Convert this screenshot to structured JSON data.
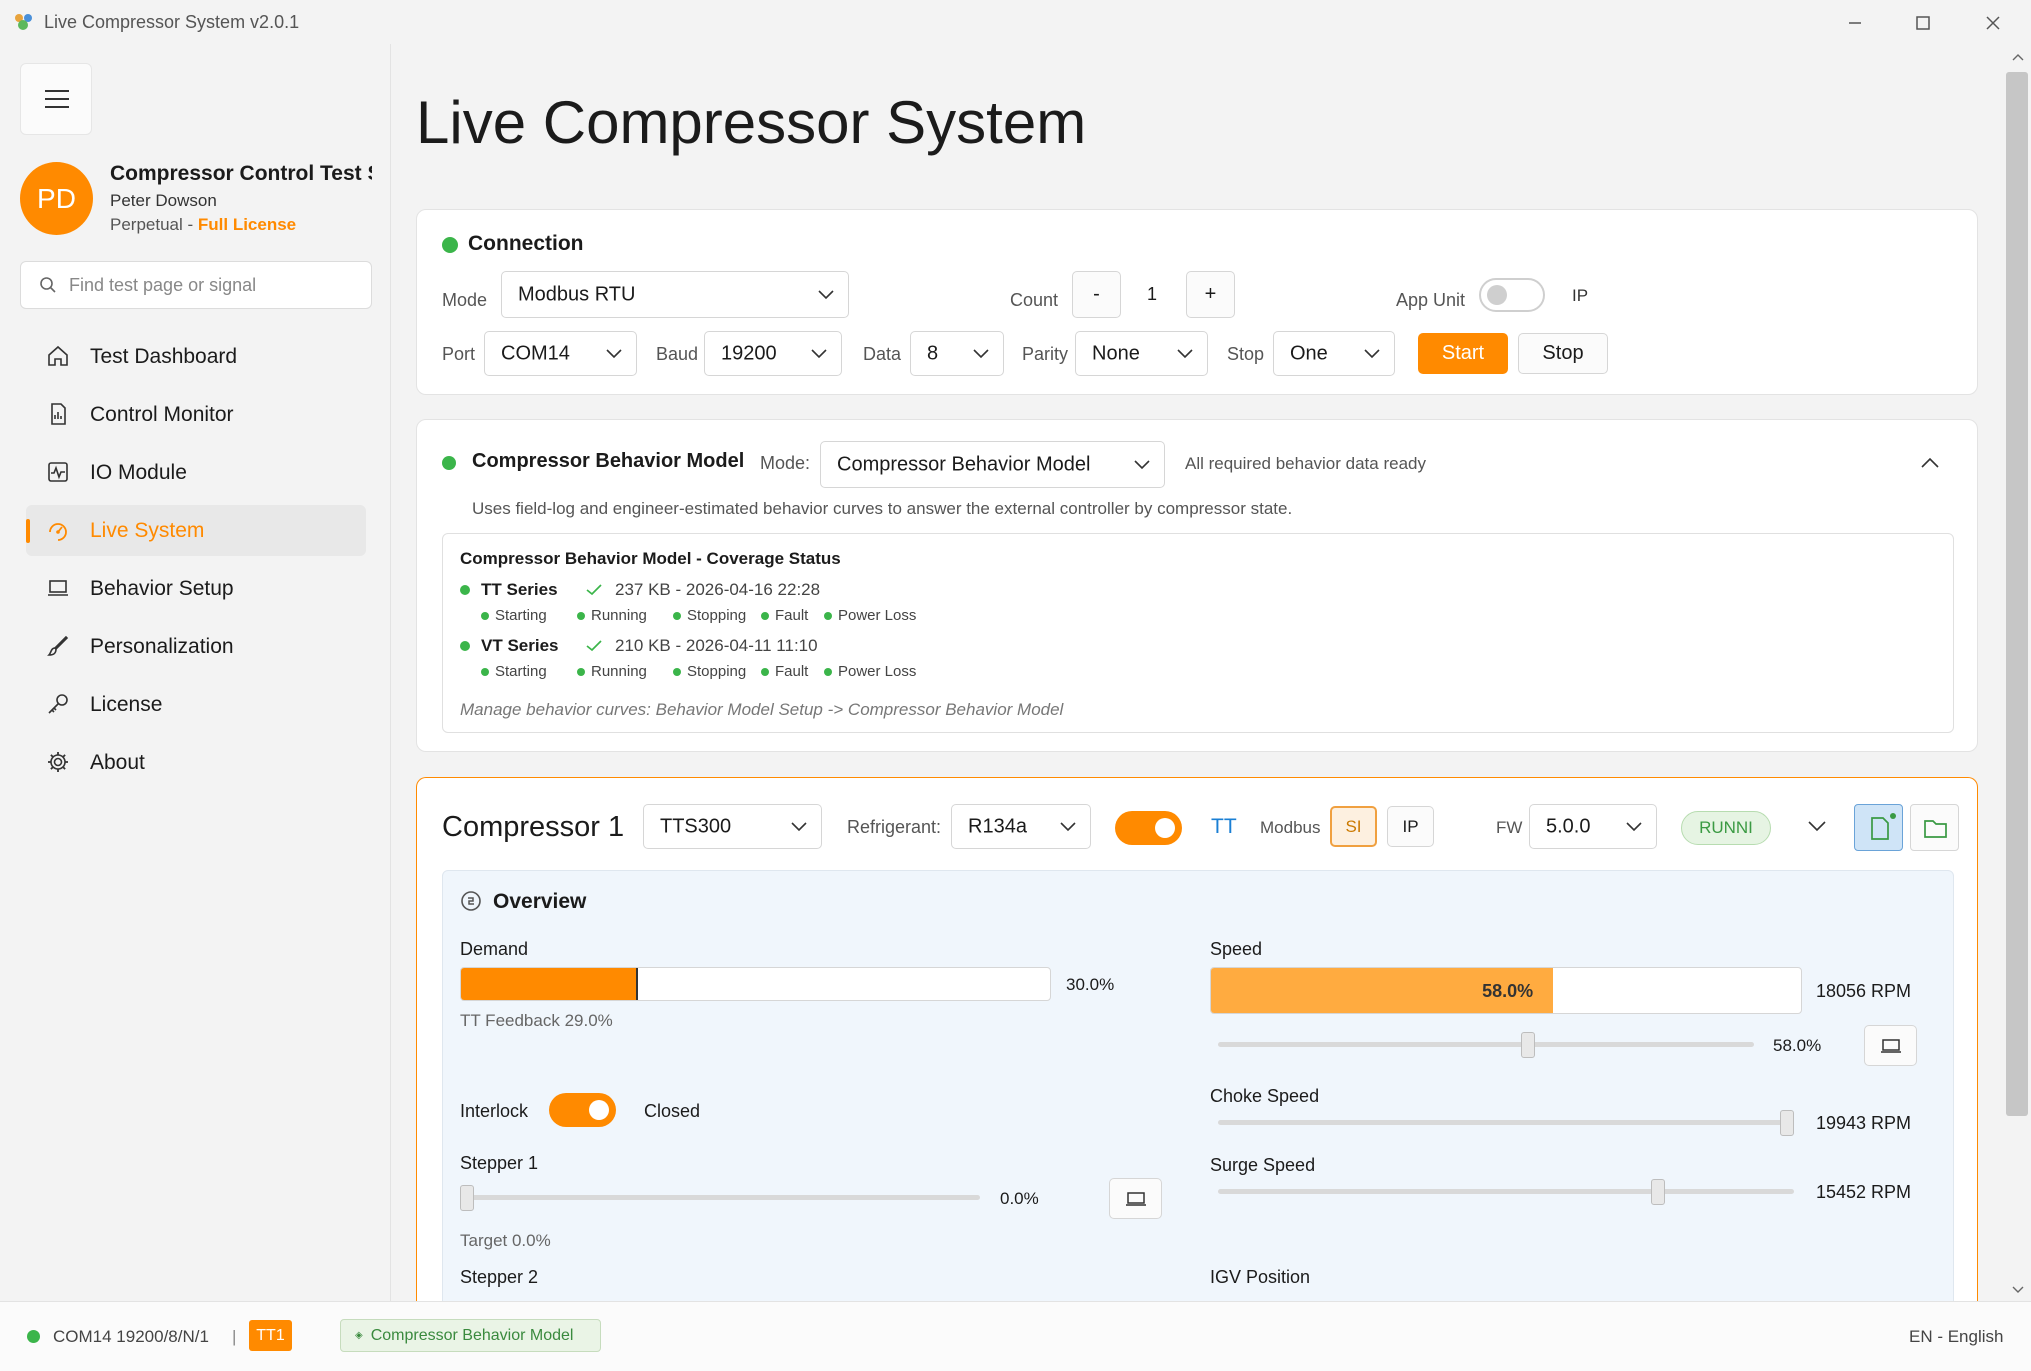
{
  "window": {
    "title": "Live Compressor System v2.0.1"
  },
  "profile": {
    "initials": "PD",
    "name": "Compressor Control Test Sir",
    "user": "Peter Dowson",
    "license_type": "Perpetual",
    "license_sep": " - ",
    "license_level": "Full License"
  },
  "search": {
    "placeholder": "Find test page or signal"
  },
  "nav": [
    {
      "label": "Test Dashboard",
      "icon": "home-icon"
    },
    {
      "label": "Control Monitor",
      "icon": "document-chart-icon"
    },
    {
      "label": "IO Module",
      "icon": "pulse-icon"
    },
    {
      "label": "Live System",
      "icon": "live-gauge-icon",
      "active": true
    },
    {
      "label": "Behavior Setup",
      "icon": "laptop-icon"
    },
    {
      "label": "Personalization",
      "icon": "brush-icon"
    },
    {
      "label": "License",
      "icon": "key-icon"
    },
    {
      "label": "About",
      "icon": "gear-icon"
    }
  ],
  "page": {
    "title": "Live Compressor System"
  },
  "connection": {
    "title": "Connection",
    "mode_label": "Mode",
    "mode_value": "Modbus RTU",
    "count_label": "Count",
    "count_minus": "-",
    "count_value": "1",
    "count_plus": "+",
    "app_unit_label": "App Unit",
    "unit_option": "IP",
    "port_label": "Port",
    "port_value": "COM14",
    "baud_label": "Baud",
    "baud_value": "19200",
    "data_label": "Data",
    "data_value": "8",
    "parity_label": "Parity",
    "parity_value": "None",
    "stop_label": "Stop",
    "stop_value": "One",
    "start_button": "Start",
    "stop_button": "Stop"
  },
  "behavior": {
    "title": "Compressor Behavior Model",
    "mode_label": "Mode:",
    "mode_value": "Compressor Behavior Model",
    "status": "All required behavior data ready",
    "description": "Uses field-log and engineer-estimated behavior curves to answer the external controller by compressor state.",
    "coverage_title": "Compressor Behavior Model - Coverage Status",
    "series": [
      {
        "name": "TT Series",
        "info": "237 KB - 2026-04-16 22:28",
        "states": [
          "Starting",
          "Running",
          "Stopping",
          "Fault",
          "Power Loss"
        ]
      },
      {
        "name": "VT Series",
        "info": "210 KB - 2026-04-11 11:10",
        "states": [
          "Starting",
          "Running",
          "Stopping",
          "Fault",
          "Power Loss"
        ]
      }
    ],
    "footer": "Manage behavior curves: Behavior Model Setup -> Compressor Behavior Model"
  },
  "compressor": {
    "title": "Compressor 1",
    "model": "TTS300",
    "refrigerant_label": "Refrigerant:",
    "refrigerant_value": "R134a",
    "type_label": "TT",
    "modbus_label": "Modbus",
    "si_label": "SI",
    "ip_label": "IP",
    "fw_label": "FW",
    "fw_value": "5.0.0",
    "state_badge": "RUNNI",
    "overview_title": "Overview",
    "demand_label": "Demand",
    "demand_value": "30.0%",
    "demand_fraction": 0.3,
    "tt_feedback": "TT Feedback 29.0%",
    "interlock_label": "Interlock",
    "interlock_state": "Closed",
    "stepper1_label": "Stepper 1",
    "stepper1_value": "0.0%",
    "stepper1_fraction": 0.0,
    "stepper1_target": "Target 0.0%",
    "stepper2_label": "Stepper 2",
    "speed_label": "Speed",
    "speed_bar_text": "58.0%",
    "speed_fraction": 0.58,
    "speed_rpm": "18056 RPM",
    "speed_slider_value": "58.0%",
    "choke_label": "Choke Speed",
    "choke_rpm": "19943 RPM",
    "choke_fraction": 1.0,
    "surge_label": "Surge Speed",
    "surge_rpm": "15452 RPM",
    "surge_fraction": 0.77,
    "igv_label": "IGV Position"
  },
  "statusbar": {
    "port": "COM14 19200/8/N/1",
    "sep": "|",
    "unit_badge": "TT1",
    "model_badge": "Compressor Behavior Model",
    "language": "EN - English"
  },
  "colors": {
    "accent": "#ff8a00",
    "ok": "#3bb54a",
    "link_blue": "#1a7fd4"
  }
}
